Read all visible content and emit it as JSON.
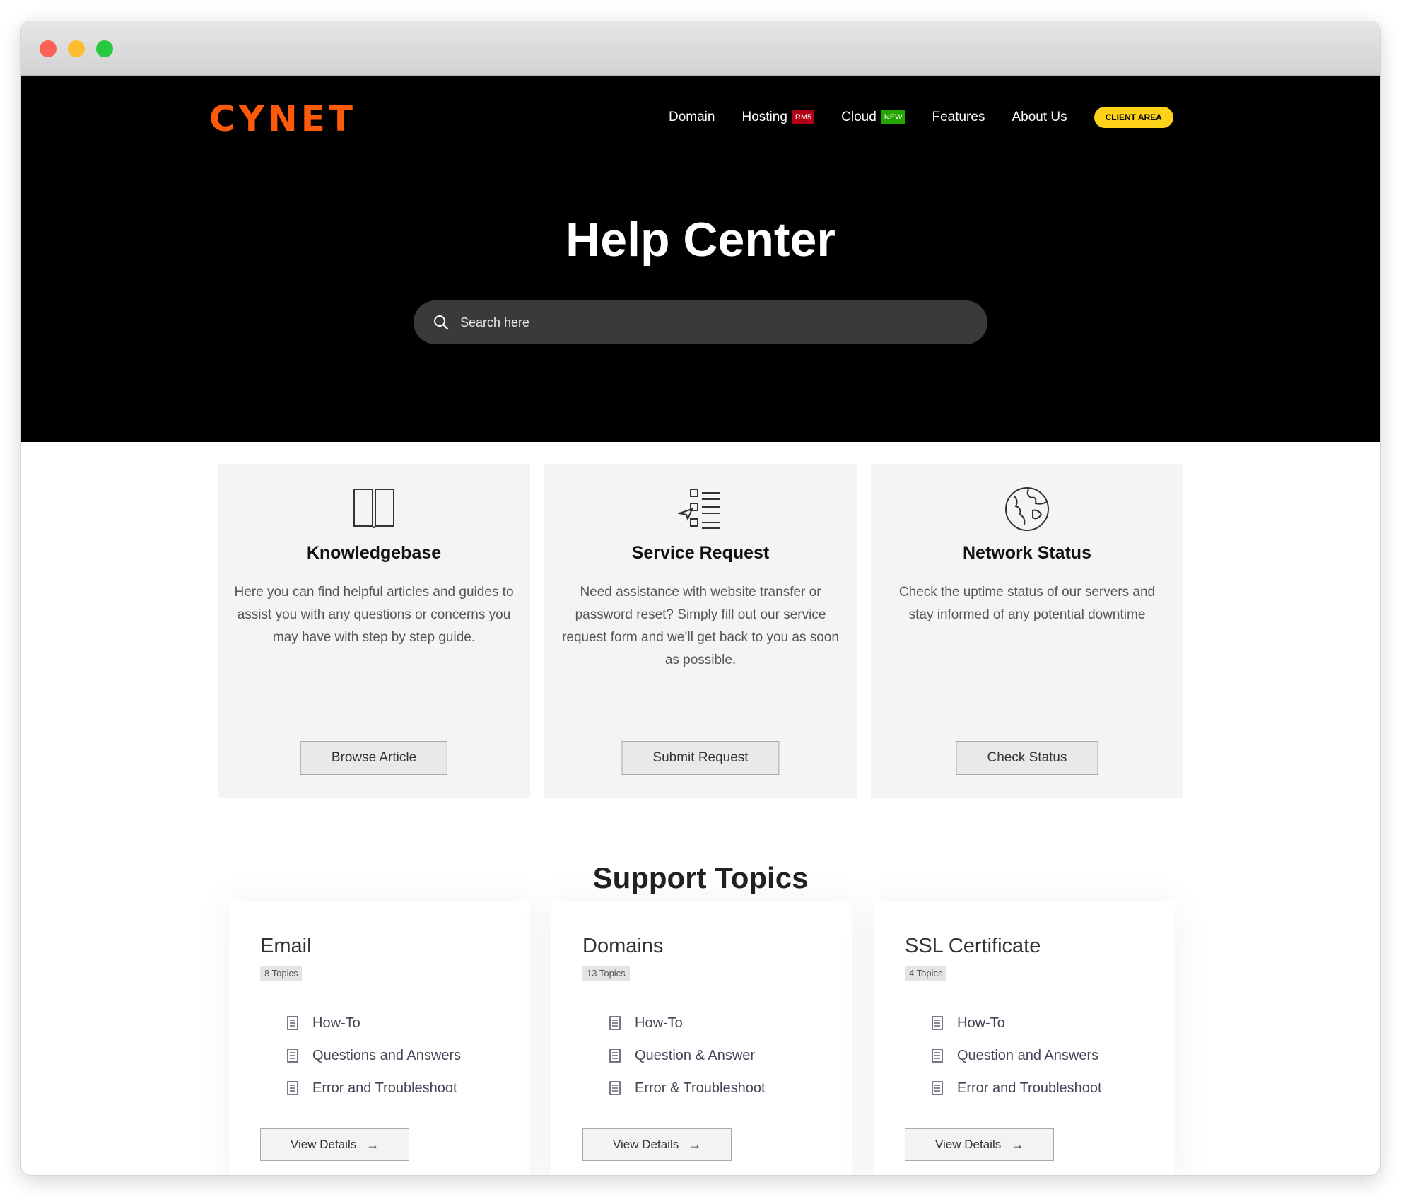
{
  "brand": {
    "logo": "CYNET",
    "accent": "#ff5a0a"
  },
  "nav": {
    "items": [
      {
        "label": "Domain"
      },
      {
        "label": "Hosting",
        "badge": "RM5",
        "badge_color": "#b10015"
      },
      {
        "label": "Cloud",
        "badge": "NEW",
        "badge_color": "#23a500"
      },
      {
        "label": "Features"
      },
      {
        "label": "About Us"
      }
    ],
    "client_area": "CLIENT AREA",
    "client_area_color": "#ffd21a"
  },
  "hero": {
    "title": "Help Center",
    "search_placeholder": "Search here",
    "search_icon": "search-icon"
  },
  "cards": [
    {
      "icon": "book-icon",
      "title": "Knowledgebase",
      "text": "Here you can find helpful articles and guides to assist you with any questions or concerns you may have with step by step guide.",
      "button": "Browse Article"
    },
    {
      "icon": "checklist-icon",
      "title": "Service Request",
      "text": "Need assistance with website transfer or password reset? Simply fill out our service request form and we’ll get back to you as soon as possible.",
      "button": "Submit Request"
    },
    {
      "icon": "globe-icon",
      "title": "Network Status",
      "text": "Check the uptime status of our servers and stay informed of any potential downtime",
      "button": "Check Status"
    }
  ],
  "support": {
    "title": "Support Topics",
    "topics": [
      {
        "name": "Email",
        "count": "8 Topics",
        "links": [
          "How-To",
          "Questions and Answers",
          "Error and Troubleshoot"
        ],
        "button": "View Details"
      },
      {
        "name": "Domains",
        "count": "13 Topics",
        "links": [
          "How-To",
          "Question & Answer",
          "Error & Troubleshoot"
        ],
        "button": "View Details"
      },
      {
        "name": "SSL Certificate",
        "count": "4 Topics",
        "links": [
          "How-To",
          "Question and Answers",
          "Error and Troubleshoot"
        ],
        "button": "View Details"
      }
    ]
  }
}
